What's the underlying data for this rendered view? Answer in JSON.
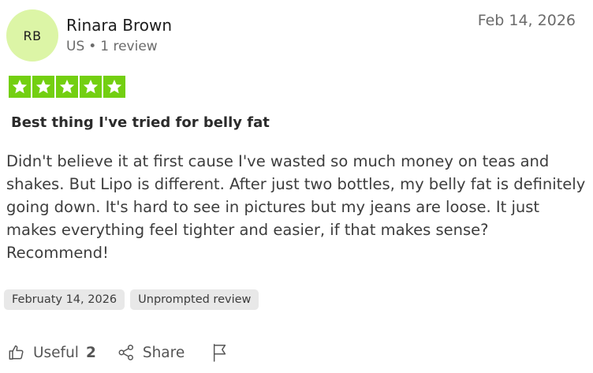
{
  "reviewer": {
    "initials": "RB",
    "name": "Rinara Brown",
    "country": "US",
    "separator": "•",
    "review_count": "1 review",
    "avatar_color": "#dcf5a6"
  },
  "review": {
    "date": "Feb 14, 2026",
    "rating": 5,
    "rating_max": 5,
    "star_color": "#73cf11",
    "title": "Best thing I've tried for belly fat",
    "body_lines": [
      "Didn't believe it at first cause I've wasted so much money on teas and",
      "shakes. But Lipo is different. After just two bottles, my belly fat is definitely",
      "going down. It's hard to see in pictures but my jeans are loose. It just",
      "makes everything feel tighter and easier, if that makes sense?",
      "Recommend!"
    ],
    "tags": {
      "experience_date": "Februaty 14, 2026",
      "source": "Unprompted review"
    }
  },
  "actions": {
    "useful_label": "Useful",
    "useful_count": "2",
    "useful_icon": "thumbs-up-icon",
    "share_label": "Share",
    "share_icon": "share-icon",
    "flag_icon": "flag-icon"
  }
}
